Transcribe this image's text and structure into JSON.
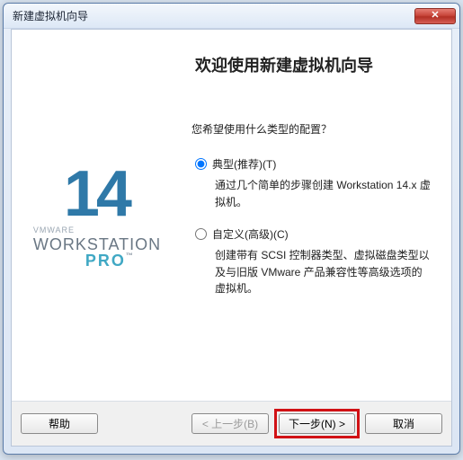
{
  "window": {
    "title": "新建虚拟机向导",
    "close_glyph": "✕"
  },
  "logo": {
    "number": "14",
    "vmware": "VMWARE",
    "workstation": "WORKSTATION",
    "pro": "PRO",
    "tm": "™"
  },
  "main": {
    "welcome": "欢迎使用新建虚拟机向导",
    "prompt": "您希望使用什么类型的配置？",
    "options": [
      {
        "label": "典型(推荐)(T)",
        "desc": "通过几个简单的步骤创建 Workstation 14.x 虚拟机。",
        "checked": true
      },
      {
        "label": "自定义(高级)(C)",
        "desc": "创建带有 SCSI 控制器类型、虚拟磁盘类型以及与旧版 VMware 产品兼容性等高级选项的虚拟机。",
        "checked": false
      }
    ]
  },
  "buttons": {
    "help": "帮助",
    "back": "< 上一步(B)",
    "next": "下一步(N) >",
    "cancel": "取消"
  }
}
